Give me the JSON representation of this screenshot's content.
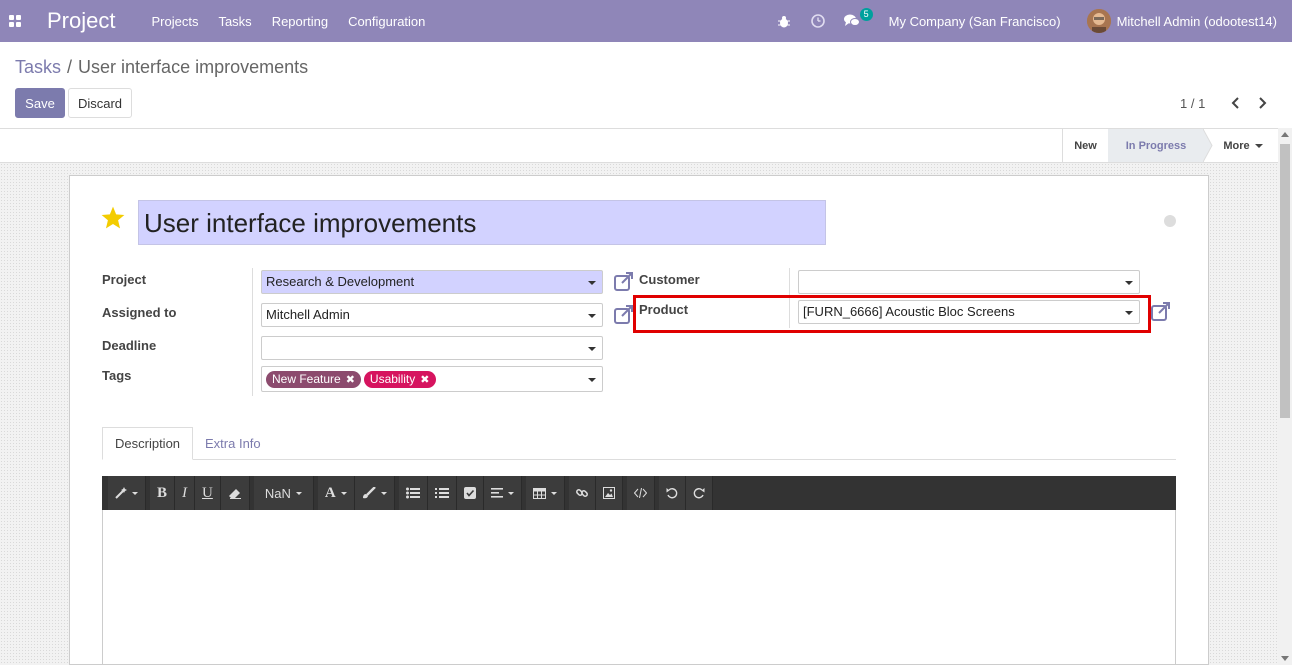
{
  "navbar": {
    "brand": "Project",
    "menu": [
      "Projects",
      "Tasks",
      "Reporting",
      "Configuration"
    ],
    "chat_count": "5",
    "company": "My Company (San Francisco)",
    "user": "Mitchell Admin (odootest14)"
  },
  "breadcrumb": {
    "parent": "Tasks",
    "separator": "/",
    "current": "User interface improvements"
  },
  "actions": {
    "save": "Save",
    "discard": "Discard"
  },
  "pager": {
    "value": "1 / 1"
  },
  "statusbar": {
    "stages": [
      "New",
      "In Progress"
    ],
    "active_stage": "In Progress",
    "more": "More"
  },
  "form": {
    "title": "User interface improvements",
    "starred": true,
    "labels": {
      "project": "Project",
      "assigned_to": "Assigned to",
      "deadline": "Deadline",
      "tags": "Tags",
      "customer": "Customer",
      "product": "Product"
    },
    "values": {
      "project": "Research & Development",
      "assigned_to": "Mitchell Admin",
      "deadline": "",
      "customer": "",
      "product": "[FURN_6666] Acoustic Bloc Screens"
    },
    "tags": [
      {
        "label": "New Feature",
        "color": "#8c4b6e"
      },
      {
        "label": "Usability",
        "color": "#d6145f"
      }
    ]
  },
  "tabs": {
    "description": "Description",
    "extra_info": "Extra Info"
  },
  "toolbar": {
    "font_size": "NaN"
  },
  "colors": {
    "primary": "#7c7bad",
    "navbar": "#8f86b8",
    "highlight": "#e00000"
  }
}
